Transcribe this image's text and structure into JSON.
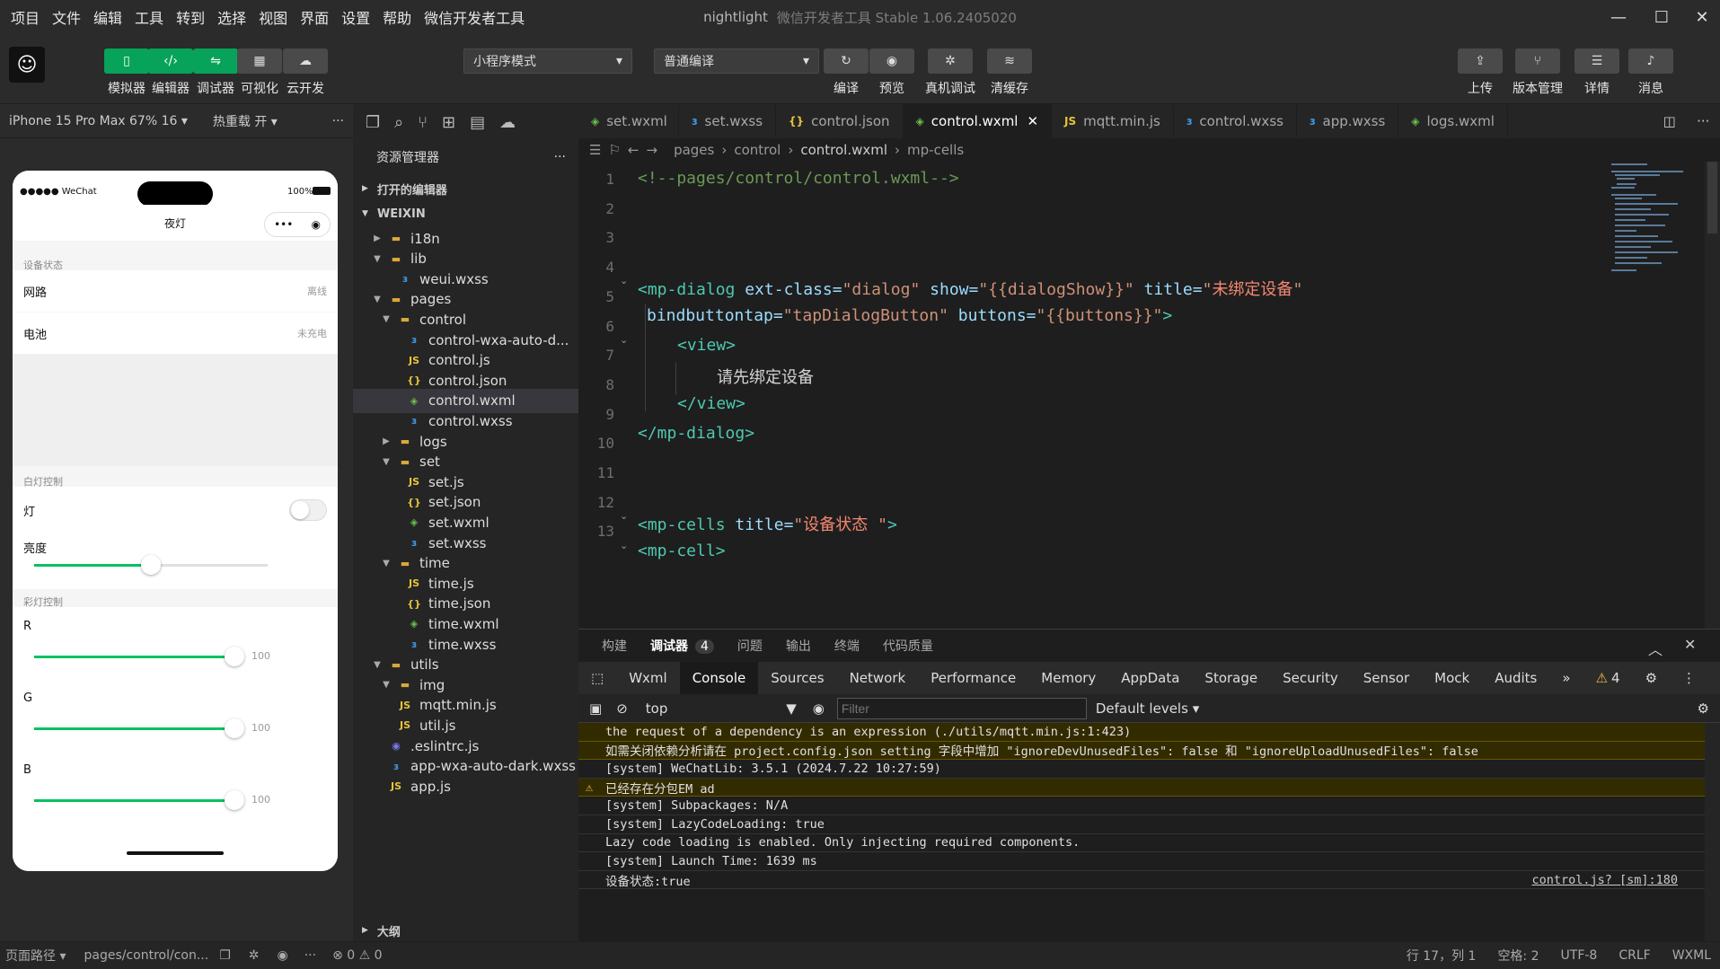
{
  "menu": [
    "项目",
    "文件",
    "编辑",
    "工具",
    "转到",
    "选择",
    "视图",
    "界面",
    "设置",
    "帮助",
    "微信开发者工具"
  ],
  "window": {
    "title": "nightlight",
    "subtitle": "微信开发者工具 Stable 1.06.2405020"
  },
  "toolbar": {
    "buttons": [
      {
        "label": "模拟器",
        "icon": "phone-icon"
      },
      {
        "label": "编辑器",
        "icon": "code-icon"
      },
      {
        "label": "调试器",
        "icon": "debug-icon"
      },
      {
        "label": "可视化",
        "icon": "layout-icon"
      },
      {
        "label": "云开发",
        "icon": "cloud-icon"
      }
    ],
    "mode_select": "小程序模式",
    "compile_select": "普通编译",
    "actions": [
      {
        "label": "编译",
        "icon": "refresh-icon"
      },
      {
        "label": "预览",
        "icon": "eye-icon"
      },
      {
        "label": "真机调试",
        "icon": "bug-icon"
      },
      {
        "label": "清缓存",
        "icon": "layers-icon"
      }
    ],
    "right": [
      {
        "label": "上传",
        "icon": "upload-icon"
      },
      {
        "label": "版本管理",
        "icon": "branch-icon"
      },
      {
        "label": "详情",
        "icon": "menu-icon"
      },
      {
        "label": "消息",
        "icon": "bell-icon"
      }
    ]
  },
  "simulator": {
    "device": "iPhone 15 Pro Max 67% 16",
    "hot_reload": "热重载 开",
    "status_left": "●●●●● WeChat",
    "status_right": "100%",
    "page_title": "夜灯",
    "sections": {
      "status_label": "设备状态",
      "network_label": "网路",
      "network_value": "离线",
      "battery_label": "电池",
      "battery_value": "未充电",
      "white_label": "白灯控制",
      "light_label": "灯",
      "brightness_label": "亮度",
      "brightness_value": 0.5,
      "color_label": "彩灯控制",
      "r_label": "R",
      "r_value": "100",
      "g_label": "G",
      "g_value": "100",
      "b_label": "B",
      "b_value": "100"
    }
  },
  "explorer": {
    "title": "资源管理器",
    "open_editors": "打开的编辑器",
    "root": "WEIXIN",
    "outline": "大纲",
    "items": [
      {
        "label": "i18n",
        "icon": "folder-icon",
        "depth": 1,
        "arrow": "right"
      },
      {
        "label": "lib",
        "icon": "folder-icon",
        "depth": 1,
        "arrow": "down"
      },
      {
        "label": "weui.wxss",
        "icon": "wxss-icon",
        "depth": 2,
        "arrow": ""
      },
      {
        "label": "pages",
        "icon": "folder-icon",
        "depth": 1,
        "arrow": "down"
      },
      {
        "label": "control",
        "icon": "folder-icon",
        "depth": 2,
        "arrow": "down"
      },
      {
        "label": "control-wxa-auto-d...",
        "icon": "wxss-icon",
        "depth": 3,
        "arrow": ""
      },
      {
        "label": "control.js",
        "icon": "js-icon",
        "depth": 3,
        "arrow": ""
      },
      {
        "label": "control.json",
        "icon": "json-icon",
        "depth": 3,
        "arrow": ""
      },
      {
        "label": "control.wxml",
        "icon": "wxml-icon",
        "depth": 3,
        "arrow": "",
        "selected": true
      },
      {
        "label": "control.wxss",
        "icon": "wxss-icon",
        "depth": 3,
        "arrow": ""
      },
      {
        "label": "logs",
        "icon": "folder-icon",
        "depth": 2,
        "arrow": "right"
      },
      {
        "label": "set",
        "icon": "folder-icon",
        "depth": 2,
        "arrow": "down"
      },
      {
        "label": "set.js",
        "icon": "js-icon",
        "depth": 3,
        "arrow": ""
      },
      {
        "label": "set.json",
        "icon": "json-icon",
        "depth": 3,
        "arrow": ""
      },
      {
        "label": "set.wxml",
        "icon": "wxml-icon",
        "depth": 3,
        "arrow": ""
      },
      {
        "label": "set.wxss",
        "icon": "wxss-icon",
        "depth": 3,
        "arrow": ""
      },
      {
        "label": "time",
        "icon": "folder-icon",
        "depth": 2,
        "arrow": "down"
      },
      {
        "label": "time.js",
        "icon": "js-icon",
        "depth": 3,
        "arrow": ""
      },
      {
        "label": "time.json",
        "icon": "json-icon",
        "depth": 3,
        "arrow": ""
      },
      {
        "label": "time.wxml",
        "icon": "wxml-icon",
        "depth": 3,
        "arrow": ""
      },
      {
        "label": "time.wxss",
        "icon": "wxss-icon",
        "depth": 3,
        "arrow": ""
      },
      {
        "label": "utils",
        "icon": "folder-icon",
        "depth": 1,
        "arrow": "down"
      },
      {
        "label": "img",
        "icon": "folder-icon",
        "depth": 2,
        "arrow": "down"
      },
      {
        "label": "mqtt.min.js",
        "icon": "js-icon",
        "depth": 2,
        "arrow": ""
      },
      {
        "label": "util.js",
        "icon": "js-icon",
        "depth": 2,
        "arrow": ""
      },
      {
        "label": ".eslintrc.js",
        "icon": "eslint-icon",
        "depth": 1,
        "arrow": ""
      },
      {
        "label": "app-wxa-auto-dark.wxss",
        "icon": "wxss-icon",
        "depth": 1,
        "arrow": ""
      },
      {
        "label": "app.js",
        "icon": "js-icon",
        "depth": 1,
        "arrow": ""
      }
    ]
  },
  "tabs": [
    {
      "label": "set.wxml",
      "icon": "wxml-icon"
    },
    {
      "label": "set.wxss",
      "icon": "wxss-icon"
    },
    {
      "label": "control.json",
      "icon": "json-icon"
    },
    {
      "label": "control.wxml",
      "icon": "wxml-icon",
      "active": true
    },
    {
      "label": "mqtt.min.js",
      "icon": "js-icon"
    },
    {
      "label": "control.wxss",
      "icon": "wxss-icon"
    },
    {
      "label": "app.wxss",
      "icon": "wxss-icon"
    },
    {
      "label": "logs.wxml",
      "icon": "wxml-icon"
    }
  ],
  "breadcrumb": [
    "pages",
    "control",
    "control.wxml",
    "mp-cells"
  ],
  "editor": {
    "lines": [
      "1",
      "2",
      "3",
      "4",
      "5",
      "6",
      "7",
      "8",
      "9",
      "10",
      "11",
      "12",
      "13"
    ],
    "comment": "<!--pages/control/control.wxml-->",
    "l4_tag": "<mp-dialog",
    "l4_a1": "ext-class=",
    "l4_v1": "\"dialog\"",
    "l4_a2": "show=",
    "l4_v2": "\"{{dialogShow}}\"",
    "l4_a3": "title=",
    "l4_q1": "\"",
    "l4_zh": "未绑定设备",
    "l4_q2": "\"",
    "l5_a": "bindbuttontap=",
    "l5_v": "\"tapDialogButton\"",
    "l5_a2": "buttons=",
    "l5_v2": "\"{{buttons}}\"",
    "l5_end": ">",
    "l6": "<view>",
    "l7": "请先绑定设备",
    "l8": "</view>",
    "l9": "</mp-dialog>",
    "l12_tag": "<mp-cells",
    "l12_a": "title=",
    "l12_q1": "\"",
    "l12_zh": "设备状态 ",
    "l12_q2": "\"",
    "l12_end": ">",
    "l13": "<mp-cell>"
  },
  "panel": {
    "tabs": [
      "构建",
      "调试器",
      "问题",
      "输出",
      "终端",
      "代码质量"
    ],
    "debugger_badge": "4",
    "devtools": [
      "Wxml",
      "Console",
      "Sources",
      "Network",
      "Performance",
      "Memory",
      "AppData",
      "Storage",
      "Security",
      "Sensor",
      "Mock",
      "Audits"
    ],
    "warn_count": "4",
    "context": "top",
    "filter_placeholder": "Filter",
    "levels": "Default levels",
    "console": [
      {
        "text": "the request of a dependency is an expression (./utils/mqtt.min.js:1:423)",
        "warn": true
      },
      {
        "text": "如需关闭依赖分析请在 project.config.json setting 字段中增加 \"ignoreDevUnusedFiles\": false 和 \"ignoreUploadUnusedFiles\": false",
        "warn": true
      },
      {
        "text": "[system] WeChatLib: 3.5.1 (2024.7.22 10:27:59)",
        "warn": false
      },
      {
        "text": "已经存在分包EM ad",
        "warn": true
      },
      {
        "text": "[system] Subpackages: N/A",
        "warn": false
      },
      {
        "text": "[system] LazyCodeLoading: true",
        "warn": false
      },
      {
        "text": "Lazy code loading is enabled. Only injecting required components.",
        "warn": false
      },
      {
        "text": "[system] Launch Time: 1639 ms",
        "warn": false
      },
      {
        "text": "设备状态:true",
        "warn": false,
        "source": "control.js? [sm]:180"
      }
    ]
  },
  "status": {
    "path_label": "页面路径",
    "path": "pages/control/con...",
    "errors": "⊗ 0 ⚠ 0",
    "position": "行 17，列 1",
    "spaces": "空格: 2",
    "encoding": "UTF-8",
    "eol": "CRLF",
    "lang": "WXML"
  },
  "colors": {
    "green": "#07a35a",
    "slider": "#07c160",
    "warn_bg": "#332b00"
  }
}
